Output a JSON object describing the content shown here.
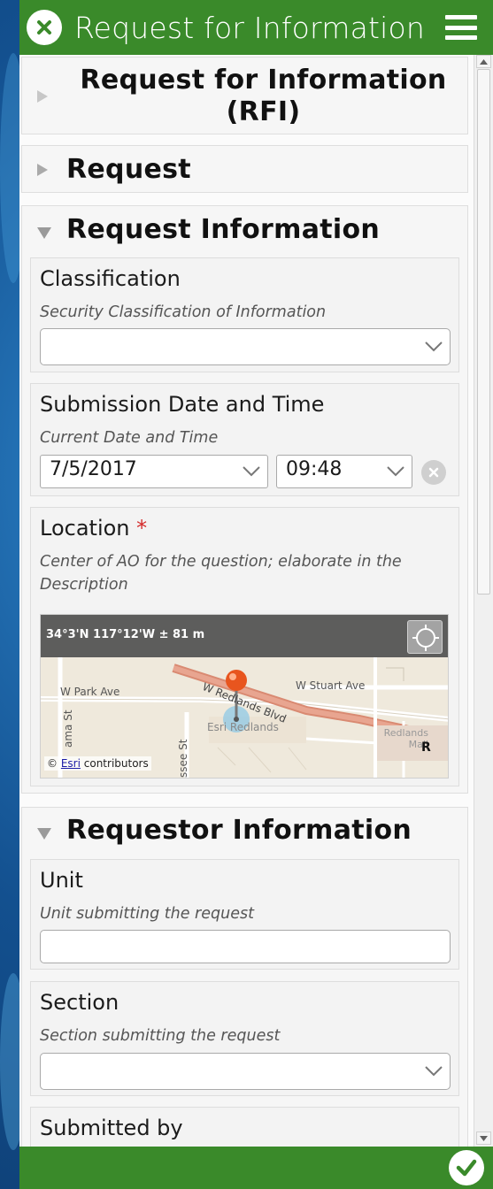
{
  "header": {
    "title": "Request for Information"
  },
  "form_title": {
    "line1": "Request for Information",
    "line2": "(RFI)"
  },
  "sections": {
    "request": {
      "title": "Request"
    },
    "request_information": {
      "title": "Request Information"
    },
    "requestor_information": {
      "title": "Requestor Information"
    }
  },
  "fields": {
    "classification": {
      "label": "Classification",
      "hint": "Security Classification of Information",
      "value": ""
    },
    "submission": {
      "label": "Submission Date and Time",
      "hint": "Current Date and Time",
      "date": "7/5/2017",
      "time": "09:48"
    },
    "location": {
      "label": "Location",
      "required_mark": "*",
      "hint_line1": "Center of AO for the question; elaborate in the",
      "hint_line2": "Description"
    },
    "unit": {
      "label": "Unit",
      "hint": "Unit submitting the request",
      "value": ""
    },
    "section": {
      "label": "Section",
      "hint": "Section submitting the request",
      "value": ""
    },
    "submitted_by": {
      "label": "Submitted by"
    }
  },
  "map": {
    "coords": "34°3'N 117°12'W ± 81 m",
    "labels": {
      "w_park_ave": "W Park Ave",
      "w_redlands_blvd": "W Redlands Blvd",
      "w_stuart_ave": "W Stuart Ave",
      "esri_redlands": "Esri Redlands",
      "redlands_mall_1": "Redlands",
      "redlands_mall_2": "Mall",
      "alabama_st": "ama St",
      "tennessee_st": "ssee St",
      "edge_r": "R"
    },
    "attribution_prefix": "©",
    "attribution_link": "Esri",
    "attribution_suffix": "contributors"
  },
  "colors": {
    "header_green": "#3a8a2a",
    "required_red": "#d42a2a"
  }
}
